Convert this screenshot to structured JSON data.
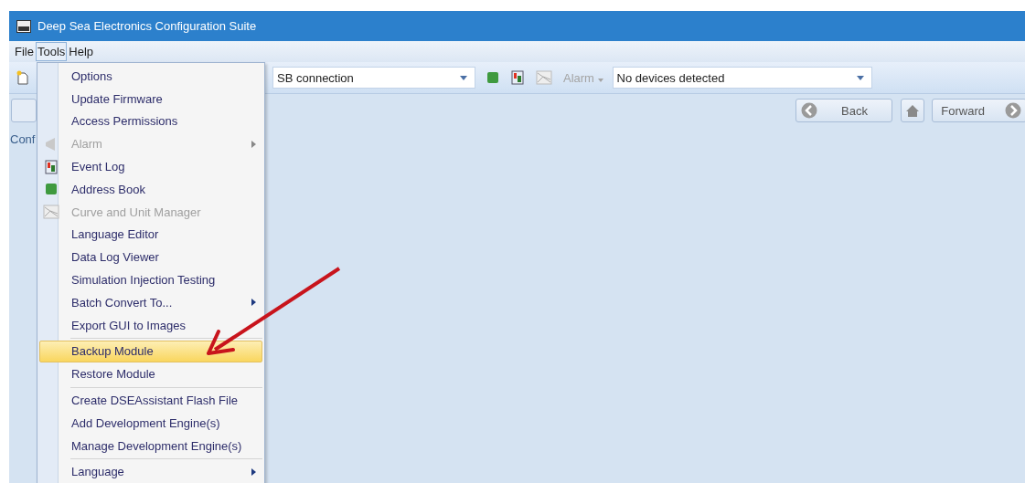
{
  "window": {
    "title": "Deep Sea Electronics Configuration Suite"
  },
  "menu_bar": [
    {
      "label": "File",
      "selected": false
    },
    {
      "label": "Tools",
      "selected": true
    },
    {
      "label": "Help",
      "selected": false
    }
  ],
  "toolbar": {
    "connection": "SB connection",
    "alarm": "Alarm",
    "devices": "No devices detected"
  },
  "nav": {
    "back": "Back",
    "forward": "Forward"
  },
  "tab": "Conf",
  "tools_menu": [
    {
      "kind": "item",
      "label": "Options",
      "disabled": false,
      "submenu": false,
      "selected": false
    },
    {
      "kind": "item",
      "label": "Update Firmware",
      "disabled": false,
      "submenu": false,
      "selected": false
    },
    {
      "kind": "item",
      "label": "Access Permissions",
      "disabled": false,
      "submenu": false,
      "selected": false
    },
    {
      "kind": "item",
      "label": "Alarm",
      "disabled": true,
      "submenu": true,
      "selected": false
    },
    {
      "kind": "item",
      "label": "Event Log",
      "disabled": false,
      "submenu": false,
      "selected": false
    },
    {
      "kind": "item",
      "label": "Address Book",
      "disabled": false,
      "submenu": false,
      "selected": false
    },
    {
      "kind": "item",
      "label": "Curve and Unit Manager",
      "disabled": true,
      "submenu": false,
      "selected": false
    },
    {
      "kind": "item",
      "label": "Language Editor",
      "disabled": false,
      "submenu": false,
      "selected": false
    },
    {
      "kind": "item",
      "label": "Data Log Viewer",
      "disabled": false,
      "submenu": false,
      "selected": false
    },
    {
      "kind": "item",
      "label": "Simulation Injection Testing",
      "disabled": false,
      "submenu": false,
      "selected": false
    },
    {
      "kind": "item",
      "label": "Batch Convert To...",
      "disabled": false,
      "submenu": true,
      "selected": false
    },
    {
      "kind": "item",
      "label": "Export GUI to Images",
      "disabled": false,
      "submenu": false,
      "selected": false
    },
    {
      "kind": "separator"
    },
    {
      "kind": "item",
      "label": "Backup Module",
      "disabled": false,
      "submenu": false,
      "selected": true
    },
    {
      "kind": "item",
      "label": "Restore Module",
      "disabled": false,
      "submenu": false,
      "selected": false
    },
    {
      "kind": "separator"
    },
    {
      "kind": "item",
      "label": "Create DSEAssistant Flash File",
      "disabled": false,
      "submenu": false,
      "selected": false
    },
    {
      "kind": "item",
      "label": "Add Development Engine(s)",
      "disabled": false,
      "submenu": false,
      "selected": false
    },
    {
      "kind": "item",
      "label": "Manage Development Engine(s)",
      "disabled": false,
      "submenu": false,
      "selected": false
    },
    {
      "kind": "separator"
    },
    {
      "kind": "item",
      "label": "Language",
      "disabled": false,
      "submenu": true,
      "selected": false
    }
  ]
}
